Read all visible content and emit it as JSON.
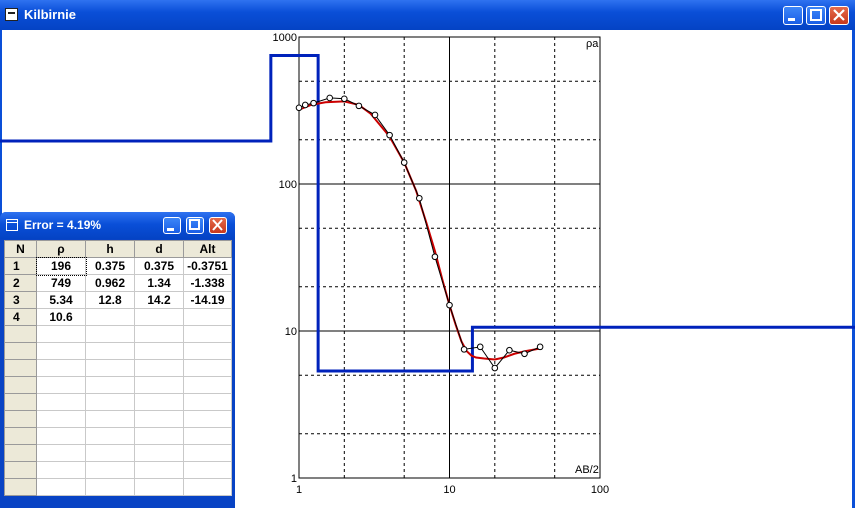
{
  "window": {
    "title": "Kilbirnie"
  },
  "chart_data": {
    "type": "line",
    "x_scale": "log",
    "y_scale": "log",
    "xlim": [
      1,
      100
    ],
    "ylim": [
      1,
      1000
    ],
    "x_tick_labels": [
      "1",
      "10",
      "100"
    ],
    "y_tick_labels": [
      "1",
      "10",
      "100",
      "1000"
    ],
    "corner_label_y": "ρa",
    "corner_label_x": "AB/2",
    "grid": true,
    "series": [
      {
        "role": "observed",
        "x": [
          1.0,
          1.1,
          1.25,
          1.6,
          2.0,
          2.5,
          3.2,
          4.0,
          5.0,
          6.3,
          8.0,
          10.0,
          12.5,
          16.0,
          20.0,
          25.0,
          31.5,
          40.0
        ],
        "y": [
          330,
          345,
          355,
          385,
          380,
          340,
          295,
          215,
          140,
          80,
          32,
          15,
          7.5,
          7.8,
          5.6,
          7.4,
          7.0,
          7.8
        ]
      },
      {
        "role": "model-curve",
        "x": [
          1.0,
          1.2,
          1.5,
          2.0,
          2.5,
          3.0,
          4.0,
          5.0,
          6.0,
          7.0,
          8.0,
          9.0,
          10.0,
          11.0,
          12.0,
          13.0,
          14.0,
          15.0,
          17.0,
          20.0,
          23.0,
          27.0,
          32.0,
          40.0
        ],
        "y": [
          320,
          345,
          360,
          365,
          345,
          300,
          210,
          140,
          90,
          55,
          35,
          22,
          15,
          11,
          8.5,
          7.3,
          6.8,
          6.6,
          6.5,
          6.4,
          6.6,
          7.0,
          7.3,
          7.6
        ]
      },
      {
        "role": "layer-model",
        "x": [
          0.1,
          1.3,
          1.3,
          14.2,
          14.2,
          200
        ],
        "y": [
          196,
          196,
          749,
          749,
          5.34,
          10.6
        ],
        "steps": [
          {
            "rho": 196,
            "x_from": 0.1,
            "x_to": 0.65
          },
          {
            "rho": 749,
            "x_from": 0.65,
            "x_to": 1.34
          },
          {
            "rho": 5.34,
            "x_from": 1.34,
            "x_to": 14.2
          },
          {
            "rho": 10.6,
            "x_from": 14.2,
            "x_to": 200
          }
        ]
      }
    ],
    "colors": {
      "observed": "#000000",
      "model_curve": "#cc0000",
      "layer_model": "#0022bb",
      "grid": "#000000"
    }
  },
  "error_window": {
    "title": "Error = 4.19%",
    "columns": [
      "N",
      "ρ",
      "h",
      "d",
      "Alt"
    ],
    "rows": [
      [
        "1",
        "196",
        "0.375",
        "0.375",
        "-0.3751"
      ],
      [
        "2",
        "749",
        "0.962",
        "1.34",
        "-1.338"
      ],
      [
        "3",
        "5.34",
        "12.8",
        "14.2",
        "-14.19"
      ],
      [
        "4",
        "10.6",
        "",
        "",
        ""
      ],
      [
        "",
        "",
        "",
        "",
        ""
      ],
      [
        "",
        "",
        "",
        "",
        ""
      ],
      [
        "",
        "",
        "",
        "",
        ""
      ],
      [
        "",
        "",
        "",
        "",
        ""
      ],
      [
        "",
        "",
        "",
        "",
        ""
      ],
      [
        "",
        "",
        "",
        "",
        ""
      ],
      [
        "",
        "",
        "",
        "",
        ""
      ],
      [
        "",
        "",
        "",
        "",
        ""
      ],
      [
        "",
        "",
        "",
        "",
        ""
      ],
      [
        "",
        "",
        "",
        "",
        ""
      ]
    ]
  }
}
